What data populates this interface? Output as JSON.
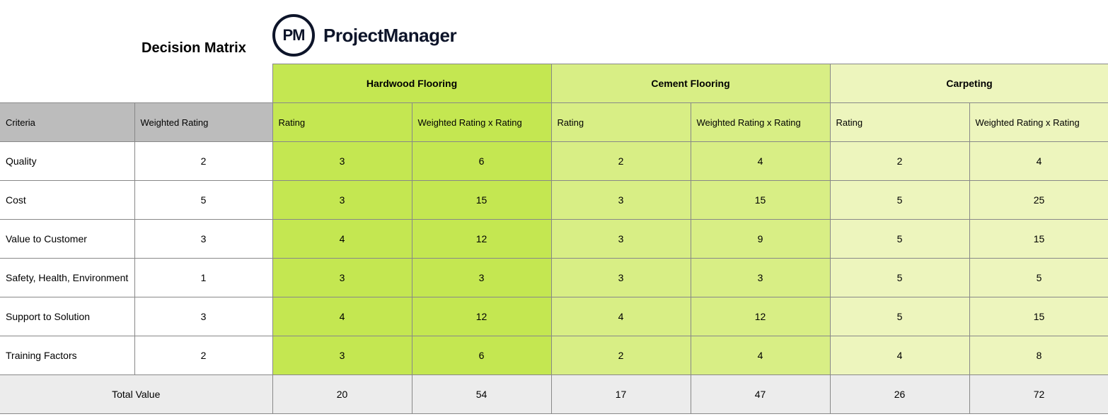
{
  "title": "Decision Matrix",
  "brand": {
    "abbrev": "PM",
    "name": "ProjectManager"
  },
  "head": {
    "criteria": "Criteria",
    "weighted": "Weighted Rating",
    "rating": "Rating",
    "wxr": "Weighted Rating x Rating",
    "total": "Total Value"
  },
  "options": [
    {
      "name": "Hardwood Flooring",
      "class": "c1"
    },
    {
      "name": "Cement Flooring",
      "class": "c2"
    },
    {
      "name": "Carpeting",
      "class": "c3"
    }
  ],
  "rows": [
    {
      "criteria": "Quality",
      "weight": 2,
      "vals": [
        [
          3,
          6
        ],
        [
          2,
          4
        ],
        [
          2,
          4
        ]
      ]
    },
    {
      "criteria": "Cost",
      "weight": 5,
      "vals": [
        [
          3,
          15
        ],
        [
          3,
          15
        ],
        [
          5,
          25
        ]
      ]
    },
    {
      "criteria": "Value to Customer",
      "weight": 3,
      "vals": [
        [
          4,
          12
        ],
        [
          3,
          9
        ],
        [
          5,
          15
        ]
      ]
    },
    {
      "criteria": "Safety, Health, Environment",
      "weight": 1,
      "vals": [
        [
          3,
          3
        ],
        [
          3,
          3
        ],
        [
          5,
          5
        ]
      ]
    },
    {
      "criteria": "Support to Solution",
      "weight": 3,
      "vals": [
        [
          4,
          12
        ],
        [
          4,
          12
        ],
        [
          5,
          15
        ]
      ]
    },
    {
      "criteria": "Training Factors",
      "weight": 2,
      "vals": [
        [
          3,
          6
        ],
        [
          2,
          4
        ],
        [
          4,
          8
        ]
      ]
    }
  ],
  "totals": [
    [
      20,
      54
    ],
    [
      17,
      47
    ],
    [
      26,
      72
    ]
  ]
}
